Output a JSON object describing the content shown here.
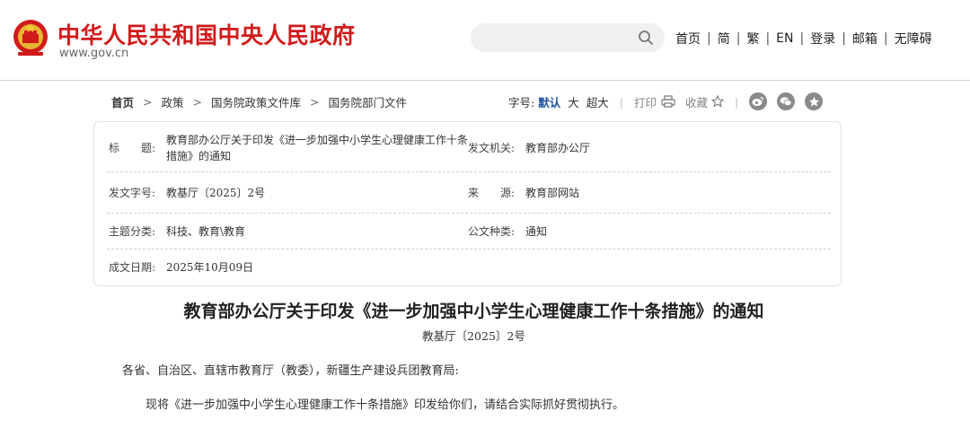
{
  "header": {
    "site_title": "中华人民共和国中央人民政府",
    "site_url": "www.gov.cn",
    "search": {
      "placeholder": ""
    },
    "nav": [
      "首页",
      "简",
      "繁",
      "EN",
      "登录",
      "邮箱",
      "无障碍"
    ],
    "brand_color": "#d11b1b"
  },
  "breadcrumb": [
    "首页",
    "政策",
    "国务院政策文件库",
    "国务院部门文件"
  ],
  "tools": {
    "font_label": "字号:",
    "font_default": "默认",
    "font_large": "大",
    "font_xlarge": "超大",
    "print": "打印",
    "favorite": "收藏",
    "share_icons": [
      "weibo-icon",
      "wechat-icon",
      "star-circle-icon"
    ]
  },
  "meta": {
    "title_label": "标　　题:",
    "title_value_line1": "教育部办公厅关于印发《进一步加强中小学生心理健康工作十条",
    "title_value_line2": "措施》的通知",
    "issuer_label": "发文机关:",
    "issuer_value": "教育部办公厅",
    "docno_label": "发文字号:",
    "docno_value": "教基厅〔2025〕2号",
    "source_label": "来　　源:",
    "source_value": "教育部网站",
    "topic_label": "主题分类:",
    "topic_value": "科技、教育\\教育",
    "type_label": "公文种类:",
    "type_value": "通知",
    "date_label": "成文日期:",
    "date_value": "2025年10月09日"
  },
  "article": {
    "title": "教育部办公厅关于印发《进一步加强中小学生心理健康工作十条措施》的通知",
    "doc_no": "教基厅〔2025〕2号",
    "addressee": "各省、自治区、直辖市教育厅（教委），新疆生产建设兵团教育局:",
    "paragraph1": "现将《进一步加强中小学生心理健康工作十条措施》印发给你们，请结合实际抓好贯彻执行。"
  }
}
